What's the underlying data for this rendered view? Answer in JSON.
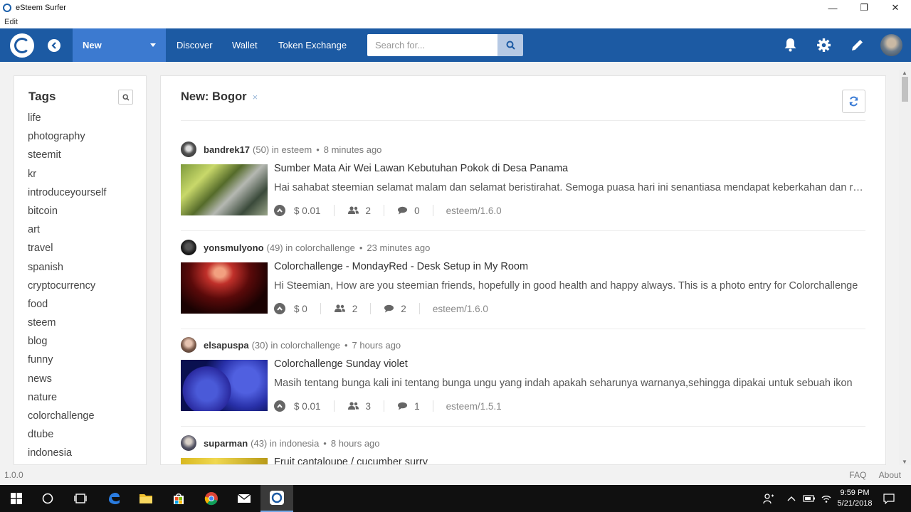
{
  "window": {
    "title": "eSteem Surfer",
    "minimize": "—",
    "maximize": "❐",
    "close": "✕"
  },
  "menu": {
    "edit": "Edit"
  },
  "nav": {
    "back_icon": "chevron-left-icon",
    "dropdown_label": "New",
    "links": [
      "Discover",
      "Wallet",
      "Token Exchange"
    ],
    "search_placeholder": "Search for..."
  },
  "sidebar": {
    "heading": "Tags",
    "tags": [
      "life",
      "photography",
      "steemit",
      "kr",
      "introduceyourself",
      "bitcoin",
      "art",
      "travel",
      "spanish",
      "cryptocurrency",
      "food",
      "steem",
      "blog",
      "funny",
      "news",
      "nature",
      "colorchallenge",
      "dtube",
      "indonesia"
    ]
  },
  "main": {
    "title": "New: Bogor",
    "close_mark": "×"
  },
  "posts": [
    {
      "author": "bandrek17",
      "rep": "(50)",
      "in": "in",
      "category": "esteem",
      "time": "8 minutes ago",
      "title": "Sumber Mata Air Wei Lawan Kebutuhan Pokok di Desa Panama",
      "summary": "Hai sahabat steemian selamat malam dan selamat beristirahat. Semoga puasa hari ini senantiasa mendapat keberkahan dan rahmat",
      "payout": "$ 0.01",
      "voters": "2",
      "comments": "0",
      "app": "esteem/1.6.0"
    },
    {
      "author": "yonsmulyono",
      "rep": "(49)",
      "in": "in",
      "category": "colorchallenge",
      "time": "23 minutes ago",
      "title": "Colorchallenge - MondayRed - Desk Setup in My Room",
      "summary": "Hi Steemian, How are you steemian friends, hopefully in good health and happy always. This is a photo entry for Colorchallenge",
      "payout": "$ 0",
      "voters": "2",
      "comments": "2",
      "app": "esteem/1.6.0"
    },
    {
      "author": "elsapuspa",
      "rep": "(30)",
      "in": "in",
      "category": "colorchallenge",
      "time": "7 hours ago",
      "title": "Colorchallenge Sunday violet",
      "summary": "Masih tentang bunga kali ini tentang bunga ungu yang indah apakah seharunya warnanya,sehingga dipakai untuk sebuah ikon",
      "payout": "$ 0.01",
      "voters": "3",
      "comments": "1",
      "app": "esteem/1.5.1"
    },
    {
      "author": "suparman",
      "rep": "(43)",
      "in": "in",
      "category": "indonesia",
      "time": "8 hours ago",
      "title": "Fruit cantaloupe / cucumber surry",
      "summary": "",
      "payout": "",
      "voters": "",
      "comments": "",
      "app": ""
    }
  ],
  "status": {
    "version": "1.0.0",
    "faq": "FAQ",
    "about": "About"
  },
  "taskbar": {
    "time": "9:59 PM",
    "date": "5/21/2018"
  },
  "colors": {
    "navbar": "#1c5aa3",
    "dropdown": "#3c7ad0",
    "accent": "#3a7bd5"
  }
}
